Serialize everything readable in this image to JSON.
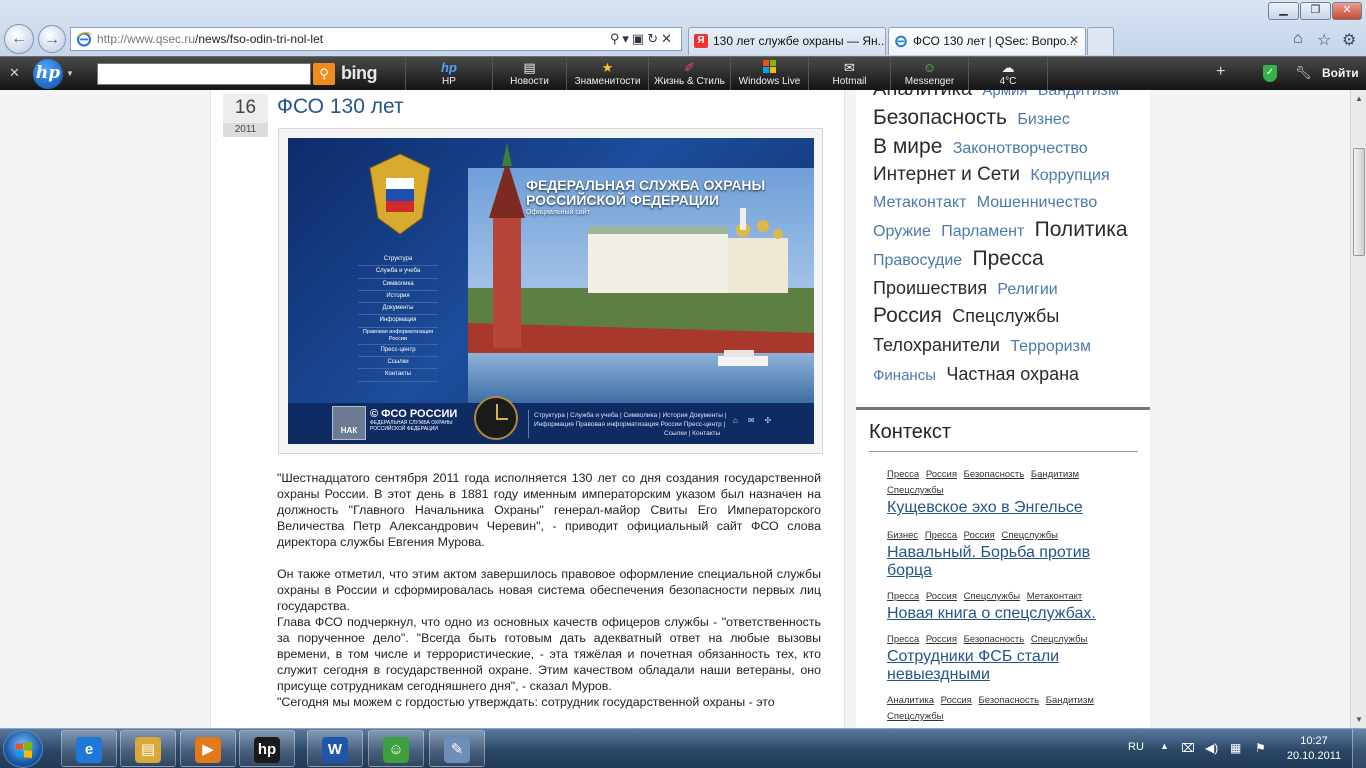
{
  "browser": {
    "url_host": "http://www.qsec.ru",
    "url_path": "/news/fso-odin-tri-nol-let",
    "tabs": [
      {
        "label": "130 лет службе охраны — Ян..."
      },
      {
        "label": "ФСО 130 лет | QSec: Вопро..."
      }
    ]
  },
  "hp_toolbar": {
    "search_brand": "bing",
    "items": [
      {
        "label": "HP",
        "icon": "hp-icon"
      },
      {
        "label": "Новости",
        "icon": "newspaper-icon"
      },
      {
        "label": "Знаменитости",
        "icon": "star-icon"
      },
      {
        "label": "Жизнь & Стиль",
        "icon": "lipstick-icon"
      },
      {
        "label": "Windows Live",
        "icon": "windows-icon"
      },
      {
        "label": "Hotmail",
        "icon": "mail-icon"
      },
      {
        "label": "Messenger",
        "icon": "messenger-icon"
      },
      {
        "label": "4°C",
        "icon": "weather-icon"
      }
    ],
    "login": "Войти"
  },
  "article": {
    "day": "16",
    "year": "2011",
    "title": "ФСО 130 лет",
    "banner": {
      "title_line1": "ФЕДЕРАЛЬНАЯ СЛУЖБА ОХРАНЫ",
      "title_line2": "РОССИЙСКОЙ ФЕДЕРАЦИИ",
      "subtitle": "Официальный сайт",
      "menu": [
        "Структура",
        "Служба и учеба",
        "Символика",
        "История",
        "Документы",
        "Информация",
        "Правовая информатизация России",
        "Пресс-центр",
        "Ссылки",
        "Контакты"
      ],
      "footer_logo": "© ФСО РОССИИ",
      "footer_sub": "ФЕДЕРАЛЬНАЯ СЛУЖБА ОХРАНЫ РОССИЙСКОЙ ФЕДЕРАЦИИ",
      "badge": "НАК",
      "footer_links1": "Структура | Служба и учеба | Символика | История Документы |",
      "footer_links2": "Информация Правовая информатизация России Пресс-центр |",
      "footer_links3": "Ссылки | Контакты"
    },
    "paragraphs": [
      "\"Шестнадцатого сентября 2011 года исполняется 130 лет со дня создания государственной охраны России. В этот день в 1881 году именным императорским указом был назначен на должность \"Главного Начальника Охраны\" генерал-майор Свиты Его Императорского Величества Петр Александрович Черевин\", - приводит официальный сайт ФСО слова директора службы Евгения Мурова.",
      "Он также отметил, что этим актом завершилось правовое оформление специальной службы охраны в России и сформировалась новая система обеспечения безопасности первых лиц государства.",
      "Глава ФСО подчеркнул, что одно из основных качеств офицеров службы - \"ответственность за порученное дело\". \"Всегда быть готовым дать адекватный ответ на любые вызовы времени, в том числе и террористические, - эта тяжёлая и почетная обязанность тех, кто служит сегодня в государственной охране. Этим качеством обладали наши ветераны, оно присуще сотрудникам сегодняшнего дня\", - сказал Муров.",
      "\"Сегодня мы можем с гордостью утверждать: сотрудник государственной охраны - это"
    ]
  },
  "sidebar": {
    "tags": [
      {
        "label": "Аналитика",
        "size": 20
      },
      {
        "label": "Армия",
        "size": 15
      },
      {
        "label": "Бандитизм",
        "size": 16
      },
      {
        "label": "Безопасность",
        "size": 21
      },
      {
        "label": "Бизнес",
        "size": 16
      },
      {
        "label": "В мире",
        "size": 21
      },
      {
        "label": "Законотворчество",
        "size": 16
      },
      {
        "label": "Интернет и Сети",
        "size": 19
      },
      {
        "label": "Коррупция",
        "size": 16
      },
      {
        "label": "Метаконтакт",
        "size": 16
      },
      {
        "label": "Мошенничество",
        "size": 16
      },
      {
        "label": "Оружие",
        "size": 16
      },
      {
        "label": "Парламент",
        "size": 16
      },
      {
        "label": "Политика",
        "size": 21
      },
      {
        "label": "Правосудие",
        "size": 16
      },
      {
        "label": "Пресса",
        "size": 21
      },
      {
        "label": "Проишествия",
        "size": 18
      },
      {
        "label": "Религии",
        "size": 16
      },
      {
        "label": "Россия",
        "size": 21
      },
      {
        "label": "Спецслужбы",
        "size": 18
      },
      {
        "label": "Телохранители",
        "size": 18
      },
      {
        "label": "Терроризм",
        "size": 16
      },
      {
        "label": "Финансы",
        "size": 15
      },
      {
        "label": "Частная охрана",
        "size": 18
      }
    ],
    "context_title": "Контекст",
    "context_items": [
      {
        "tags": [
          "Пресса",
          "Россия",
          "Безопасность",
          "Бандитизм",
          "Спецслужбы"
        ],
        "title": "Кущевское эхо в Энгельсе"
      },
      {
        "tags": [
          "Бизнес",
          "Пресса",
          "Россия",
          "Спецслужбы"
        ],
        "title": "Навальный. Борьба против борца"
      },
      {
        "tags": [
          "Пресса",
          "Россия",
          "Спецслужбы",
          "Метаконтакт"
        ],
        "title": "Новая книга о спецслужбах."
      },
      {
        "tags": [
          "Пресса",
          "Россия",
          "Безопасность",
          "Спецслужбы"
        ],
        "title": "Сотрудники ФСБ стали невыездными"
      },
      {
        "tags": [
          "Аналитика",
          "Россия",
          "Безопасность",
          "Бандитизм",
          "Спецслужбы"
        ],
        "title": ""
      }
    ]
  },
  "taskbar": {
    "apps": [
      {
        "name": "internet-explorer",
        "glyph": "e",
        "color": "#1e78d6"
      },
      {
        "name": "file-explorer",
        "glyph": "▤",
        "color": "#d9a937"
      },
      {
        "name": "media-player",
        "glyph": "▶",
        "color": "#e07a1d"
      },
      {
        "name": "hp-app",
        "glyph": "hp",
        "color": "#1a1a1a"
      },
      {
        "name": "word",
        "glyph": "W",
        "color": "#1f56a8"
      },
      {
        "name": "messenger",
        "glyph": "☺",
        "color": "#3e9f3e"
      },
      {
        "name": "paint",
        "glyph": "✎",
        "color": "#6e8fb8"
      }
    ],
    "lang": "RU",
    "time": "10:27",
    "date": "20.10.2011"
  }
}
